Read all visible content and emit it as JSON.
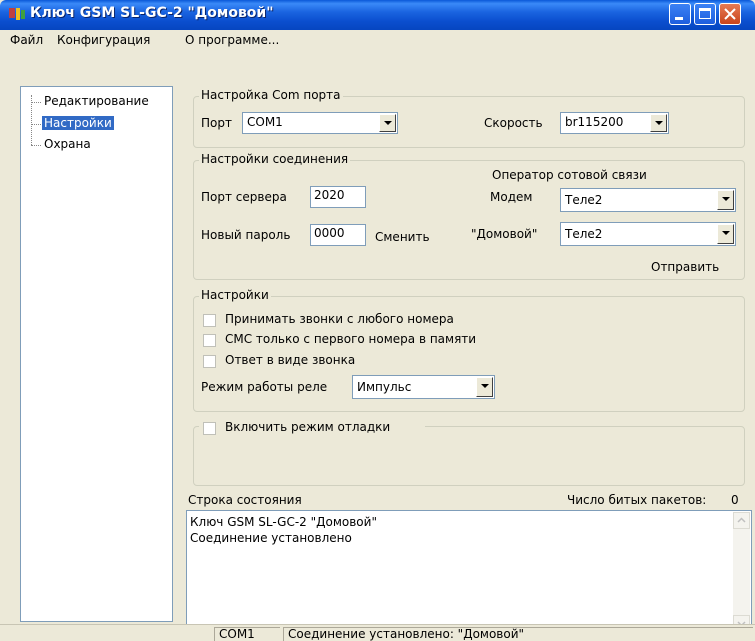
{
  "window": {
    "title": "Ключ GSM SL-GC-2 \"Домовой\""
  },
  "menu": [
    "Файл",
    "Конфигурация",
    "О программе..."
  ],
  "tree": {
    "items": [
      {
        "label": "Редактирование",
        "selected": false
      },
      {
        "label": "Настройки",
        "selected": true
      },
      {
        "label": "Охрана",
        "selected": false
      }
    ]
  },
  "com_port": {
    "group_title": "Настройка Com порта",
    "port_label": "Порт",
    "port_value": "COM1",
    "speed_label": "Скорость",
    "speed_value": "br115200"
  },
  "connection": {
    "group_title": "Настройки соединения",
    "server_port_label": "Порт сервера",
    "server_port_value": "2020",
    "new_password_label": "Новый пароль",
    "new_password_value": "0000",
    "change_label": "Сменить",
    "operator_title": "Оператор сотовой связи",
    "modem_label": "Модем",
    "modem_value": "Теле2",
    "domovoy_label": "\"Домовой\"",
    "domovoy_value": "Теле2",
    "send_label": "Отправить"
  },
  "settings": {
    "group_title": "Настройки",
    "checkboxes": [
      {
        "label": "Принимать звонки с любого номера",
        "checked": false
      },
      {
        "label": "СМС только с первого номера в памяти",
        "checked": false
      },
      {
        "label": "Ответ в виде звонка",
        "checked": false
      }
    ],
    "relay_label": "Режим работы реле",
    "relay_value": "Импульс"
  },
  "debug": {
    "label": "Включить режим отладки",
    "checked": false
  },
  "status": {
    "label": "Строка состояния",
    "bad_packets_label": "Число битых пакетов:",
    "bad_packets_value": "0",
    "lines": [
      "Ключ GSM SL-GC-2 \"Домовой\"",
      "Соединение установлено"
    ]
  },
  "statusbar": {
    "port": "COM1",
    "message": "Соединение установлено: \"Домовой\""
  },
  "colors": {
    "titlebar": "#0a58d8",
    "selection": "#316ac5",
    "window_bg": "#ece9d8",
    "close_button": "#c8441c"
  }
}
